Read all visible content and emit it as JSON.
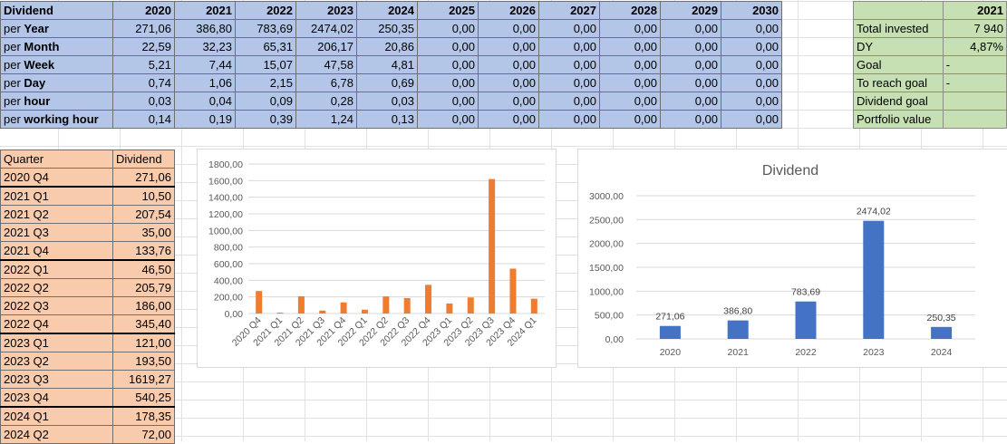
{
  "top_table": {
    "header": [
      "Dividend",
      "2020",
      "2021",
      "2022",
      "2023",
      "2024",
      "2025",
      "2026",
      "2027",
      "2028",
      "2029",
      "2030"
    ],
    "rows": [
      {
        "prefix": "per ",
        "bold": "Year",
        "values": [
          "271,06",
          "386,80",
          "783,69",
          "2474,02",
          "250,35",
          "0,00",
          "0,00",
          "0,00",
          "0,00",
          "0,00",
          "0,00"
        ]
      },
      {
        "prefix": "per ",
        "bold": "Month",
        "values": [
          "22,59",
          "32,23",
          "65,31",
          "206,17",
          "20,86",
          "0,00",
          "0,00",
          "0,00",
          "0,00",
          "0,00",
          "0,00"
        ]
      },
      {
        "prefix": "per ",
        "bold": "Week",
        "values": [
          "5,21",
          "7,44",
          "15,07",
          "47,58",
          "4,81",
          "0,00",
          "0,00",
          "0,00",
          "0,00",
          "0,00",
          "0,00"
        ]
      },
      {
        "prefix": "per ",
        "bold": "Day",
        "values": [
          "0,74",
          "1,06",
          "2,15",
          "6,78",
          "0,69",
          "0,00",
          "0,00",
          "0,00",
          "0,00",
          "0,00",
          "0,00"
        ]
      },
      {
        "prefix": "per ",
        "bold": "hour",
        "values": [
          "0,03",
          "0,04",
          "0,09",
          "0,28",
          "0,03",
          "0,00",
          "0,00",
          "0,00",
          "0,00",
          "0,00",
          "0,00"
        ]
      },
      {
        "prefix": "per ",
        "bold": "working hour",
        "values": [
          "0,14",
          "0,19",
          "0,39",
          "1,24",
          "0,13",
          "0,00",
          "0,00",
          "0,00",
          "0,00",
          "0,00",
          "0,00"
        ]
      }
    ]
  },
  "side_table": {
    "header_year": "2021",
    "rows": [
      {
        "label": "Total invested",
        "value": "7 940"
      },
      {
        "label": "DY",
        "value": "4,87%"
      },
      {
        "label": "Goal",
        "value": "-"
      },
      {
        "label": "To reach goal",
        "value": "-"
      },
      {
        "label": "Dividend goal",
        "value": ""
      },
      {
        "label": "Portfolio value",
        "value": ""
      }
    ]
  },
  "quarter_table": {
    "header": [
      "Quarter",
      "Dividend"
    ],
    "rows": [
      {
        "q": "2020 Q4",
        "v": "271,06"
      },
      {
        "q": "2021 Q1",
        "v": "10,50"
      },
      {
        "q": "2021 Q2",
        "v": "207,54"
      },
      {
        "q": "2021 Q3",
        "v": "35,00"
      },
      {
        "q": "2021 Q4",
        "v": "133,76"
      },
      {
        "q": "2022 Q1",
        "v": "46,50"
      },
      {
        "q": "2022 Q2",
        "v": "205,79"
      },
      {
        "q": "2022 Q3",
        "v": "186,00"
      },
      {
        "q": "2022 Q4",
        "v": "345,40"
      },
      {
        "q": "2023 Q1",
        "v": "121,00"
      },
      {
        "q": "2023 Q2",
        "v": "193,50"
      },
      {
        "q": "2023 Q3",
        "v": "1619,27"
      },
      {
        "q": "2023 Q4",
        "v": "540,25"
      },
      {
        "q": "2024 Q1",
        "v": "178,35"
      },
      {
        "q": "2024 Q2",
        "v": "72,00"
      }
    ]
  },
  "colors": {
    "orange_bar": "#ed7d31",
    "blue_bar": "#4472c4"
  },
  "chart_data": [
    {
      "type": "bar",
      "title": "",
      "categories": [
        "2020 Q4",
        "2021 Q1",
        "2021 Q2",
        "2021 Q3",
        "2021 Q4",
        "2022 Q1",
        "2022 Q2",
        "2022 Q3",
        "2022 Q4",
        "2023 Q1",
        "2023 Q2",
        "2023 Q3",
        "2023 Q4",
        "2024 Q1"
      ],
      "values": [
        271.06,
        10.5,
        207.54,
        35.0,
        133.76,
        46.5,
        205.79,
        186.0,
        345.4,
        121.0,
        193.5,
        1619.27,
        540.25,
        178.35
      ],
      "ylim": [
        0,
        1800
      ],
      "yticks": [
        "0,00",
        "200,00",
        "400,00",
        "600,00",
        "800,00",
        "1000,00",
        "1200,00",
        "1400,00",
        "1600,00",
        "1800,00"
      ],
      "grid": true
    },
    {
      "type": "bar",
      "title": "Dividend",
      "categories": [
        "2020",
        "2021",
        "2022",
        "2023",
        "2024"
      ],
      "values": [
        271.06,
        386.8,
        783.69,
        2474.02,
        250.35
      ],
      "data_labels": [
        "271,06",
        "386,80",
        "783,69",
        "2474,02",
        "250,35"
      ],
      "ylim": [
        0,
        3000
      ],
      "yticks": [
        "0,00",
        "500,00",
        "1000,00",
        "1500,00",
        "2000,00",
        "2500,00",
        "3000,00"
      ],
      "grid": true
    }
  ]
}
